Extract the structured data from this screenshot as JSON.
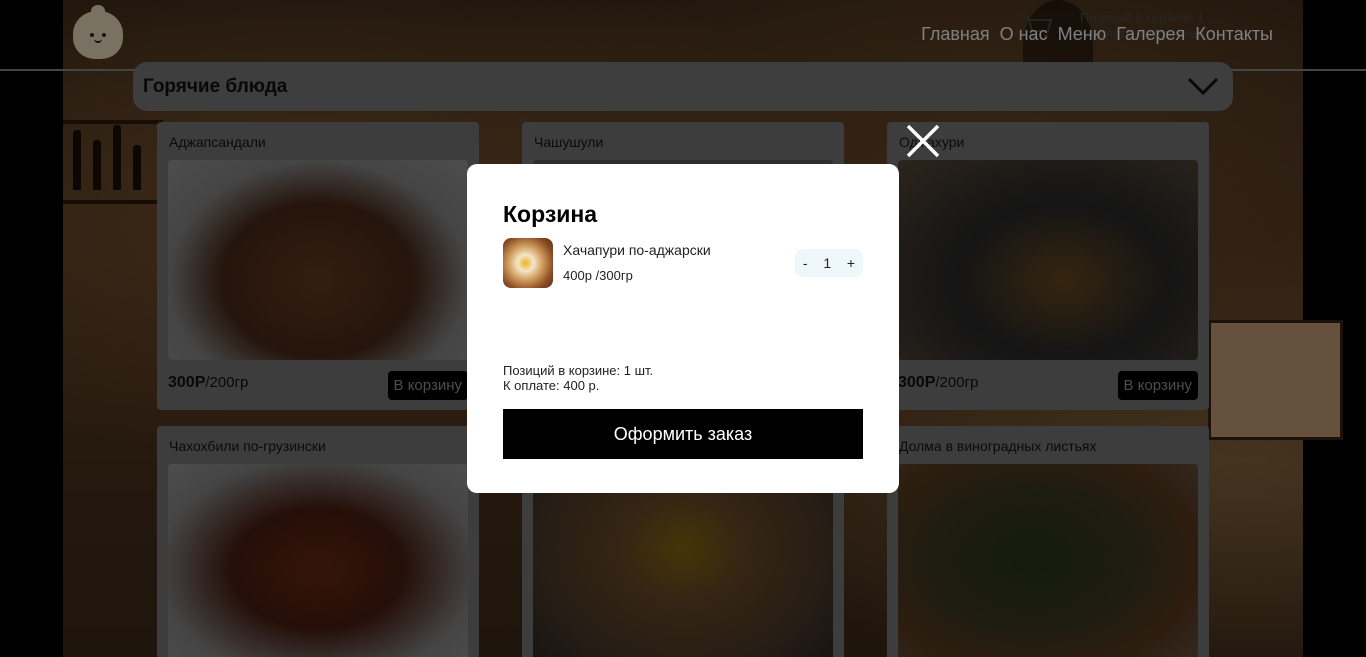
{
  "header": {
    "nav": [
      "Главная",
      "О нас",
      "Меню",
      "Галерея",
      "Контакты"
    ],
    "cart_count_text": "Позиций в корзине 1",
    "cart_total_text": "К оплате 400 рублей"
  },
  "category": {
    "title": "Горячие блюда"
  },
  "products": [
    {
      "name": "Аджапсандали",
      "price": "300Р",
      "weight": "/200гр",
      "button": "В корзину"
    },
    {
      "name": "Чашушули"
    },
    {
      "name": "Оджахури",
      "price": "300Р",
      "weight": "/200гр",
      "button": "В корзину"
    },
    {
      "name": "Чахохбили по-грузински"
    },
    {
      "name": "Долма в виноградных листьях"
    }
  ],
  "modal": {
    "title": "Корзина",
    "item": {
      "name": "Хачапури по-аджарски",
      "meta": "400р /300гр",
      "qty": "1",
      "minus": "-",
      "plus": "+"
    },
    "summary_count": "Позиций в корзине: 1 шт.",
    "summary_total": "К оплате: 400 р.",
    "order_button": "Оформить заказ"
  },
  "colors": {
    "accent": "#000000",
    "stepper_bg": "#eef7f9"
  }
}
